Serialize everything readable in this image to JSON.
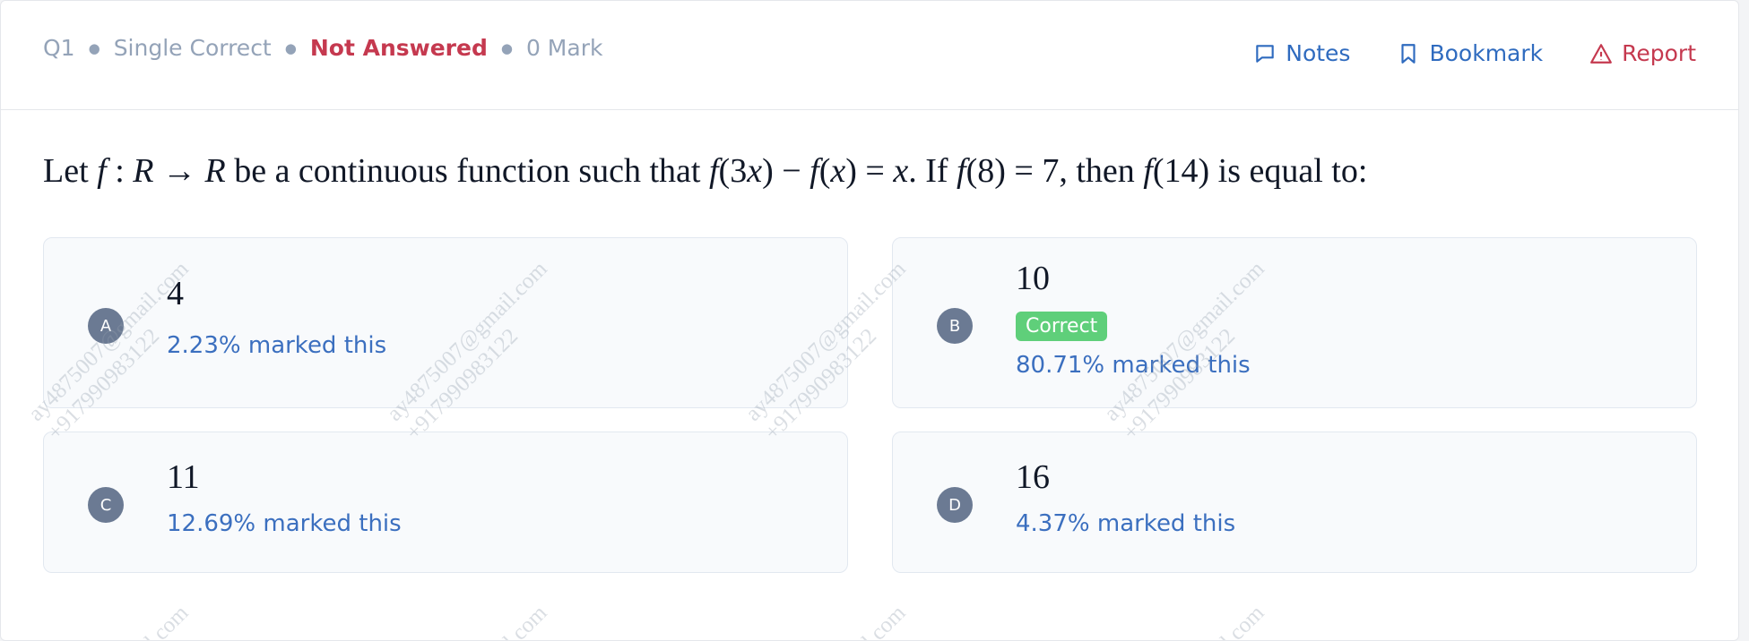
{
  "header": {
    "qnum": "Q1",
    "qtype": "Single Correct",
    "status": "Not Answered",
    "marks": "0 Mark",
    "actions": {
      "notes": "Notes",
      "bookmark": "Bookmark",
      "report": "Report"
    }
  },
  "question": {
    "p1": "Let ",
    "f1": "f",
    "p2": " : ",
    "r1": "R",
    "p3": " → ",
    "r2": "R",
    "p4": " be a continuous function such that ",
    "f2": "f",
    "p5": "(3",
    "x1": "x",
    "p6": ") − ",
    "f3": "f",
    "p7": "(",
    "x2": "x",
    "p8": ") = ",
    "x3": "x",
    "p9": ". If ",
    "f4": "f",
    "p10": "(8) = 7, then ",
    "f5": "f",
    "p11": "(14) is equal to:"
  },
  "options": [
    {
      "letter": "A",
      "value": "4",
      "marked": "2.23% marked this"
    },
    {
      "letter": "B",
      "value": "10",
      "marked": "80.71% marked this",
      "badge": "Correct"
    },
    {
      "letter": "C",
      "value": "11",
      "marked": "12.69% marked this"
    },
    {
      "letter": "D",
      "value": "16",
      "marked": "4.37% marked this"
    }
  ],
  "watermark": {
    "email": "ay4875007@gmail.com",
    "phone": "+917990983122",
    "email_tail": "il.com"
  },
  "colors": {
    "status": "#c5394f",
    "link": "#2f6bbf",
    "correct": "#5fcf7a",
    "percent": "#3b6fbf"
  }
}
